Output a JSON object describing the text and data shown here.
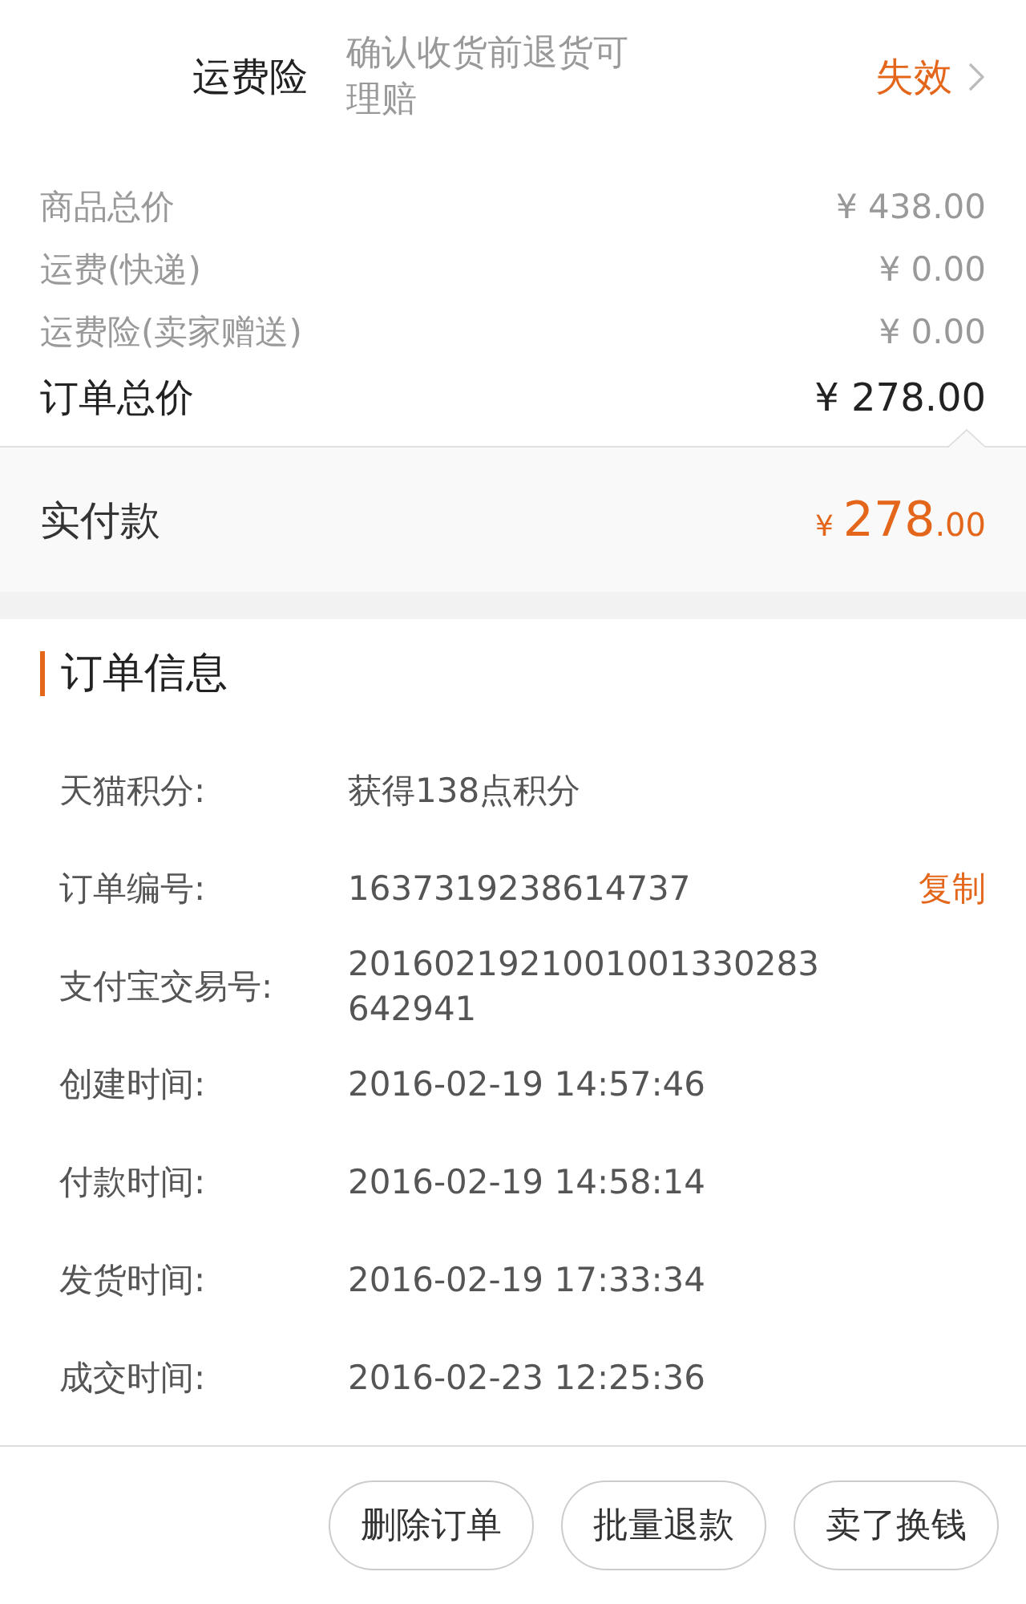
{
  "insurance": {
    "label": "运费险",
    "description": "确认收货前退货可理赔",
    "status": "失效"
  },
  "price_lines": [
    {
      "kind": "minor",
      "label": "商品总价",
      "amount": "¥ 438.00"
    },
    {
      "kind": "minor",
      "label": "运费(快递)",
      "amount": "¥ 0.00"
    },
    {
      "kind": "minor",
      "label": "运费险(卖家赠送)",
      "amount": "¥ 0.00"
    },
    {
      "kind": "total",
      "label": "订单总价",
      "amount": "¥ 278.00"
    }
  ],
  "paid": {
    "label": "实付款",
    "currency": "¥",
    "integer": "278",
    "decimal": ".00"
  },
  "order_info": {
    "title": "订单信息",
    "rows": [
      {
        "label": "天猫积分:",
        "value": "获得138点积分"
      },
      {
        "label": "订单编号:",
        "value": "1637319238614737",
        "action": "复制"
      },
      {
        "label": "支付宝交易号:",
        "value": "2016021921001001330283 642941"
      },
      {
        "label": "创建时间:",
        "value": "2016-02-19 14:57:46"
      },
      {
        "label": "付款时间:",
        "value": "2016-02-19 14:58:14"
      },
      {
        "label": "发货时间:",
        "value": "2016-02-19 17:33:34"
      },
      {
        "label": "成交时间:",
        "value": "2016-02-23 12:25:36"
      }
    ]
  },
  "buttons": [
    "删除订单",
    "批量退款",
    "卖了换钱"
  ]
}
